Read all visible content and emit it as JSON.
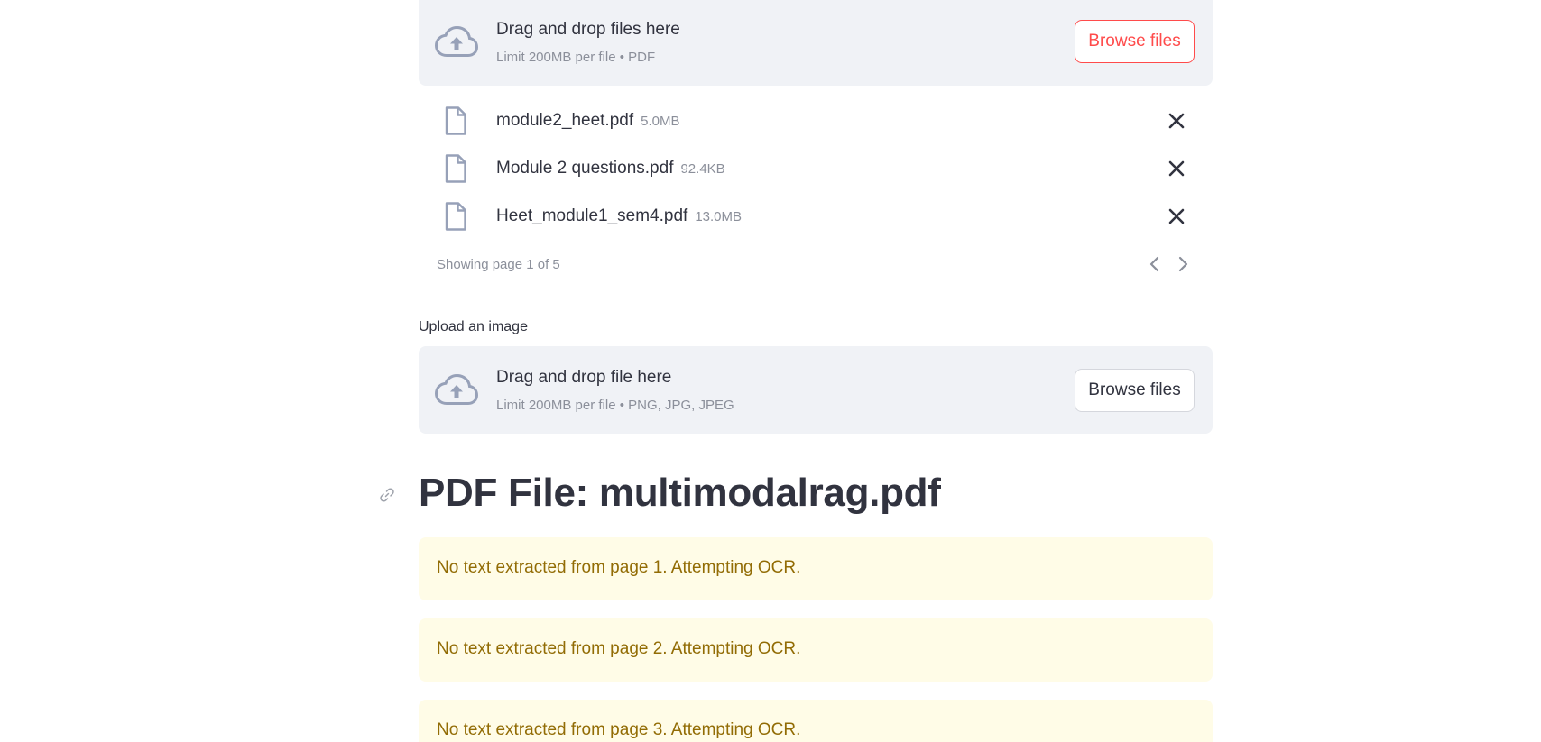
{
  "pdf_uploader": {
    "drop_title": "Drag and drop files here",
    "drop_hint": "Limit 200MB per file • PDF",
    "browse_label": "Browse files",
    "files": [
      {
        "name": "module2_heet.pdf",
        "size": "5.0MB"
      },
      {
        "name": "Module 2 questions.pdf",
        "size": "92.4KB"
      },
      {
        "name": "Heet_module1_sem4.pdf",
        "size": "13.0MB"
      }
    ],
    "pagination": "Showing page 1 of 5"
  },
  "image_uploader": {
    "label": "Upload an image",
    "drop_title": "Drag and drop file here",
    "drop_hint": "Limit 200MB per file • PNG, JPG, JPEG",
    "browse_label": "Browse files"
  },
  "heading": "PDF File: multimodalrag.pdf",
  "alerts": [
    "No text extracted from page 1. Attempting OCR.",
    "No text extracted from page 2. Attempting OCR.",
    "No text extracted from page 3. Attempting OCR."
  ],
  "colors": {
    "accent": "#ff4b4b",
    "dropzone_bg": "#f0f2f6",
    "warning_bg": "#fffce7",
    "warning_text": "#926c05"
  },
  "icons": {
    "upload": "cloud-upload-icon",
    "file": "file-icon",
    "remove": "close-icon",
    "prev": "chevron-left-icon",
    "next": "chevron-right-icon",
    "anchor": "link-icon"
  }
}
